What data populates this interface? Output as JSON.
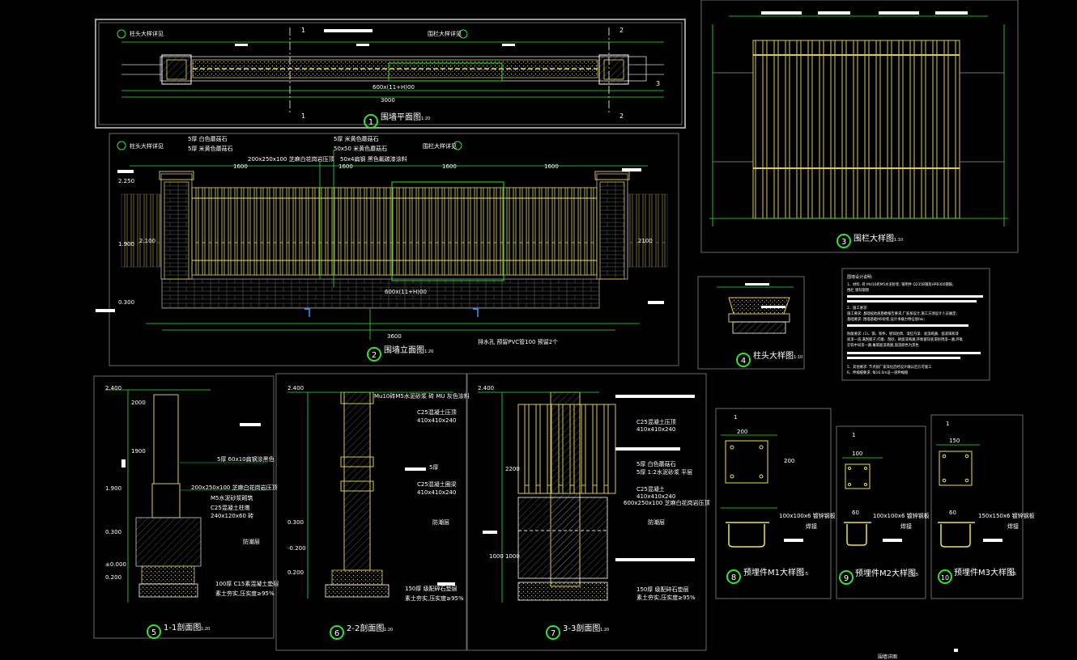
{
  "views": {
    "v1": {
      "num": "1",
      "title": "围墙平面图",
      "scale": "1:20"
    },
    "v2": {
      "num": "2",
      "title": "围墙立面图",
      "scale": "1:20"
    },
    "v3": {
      "num": "3",
      "title": "围栏大样图",
      "scale": "1:10"
    },
    "v4": {
      "num": "4",
      "title": "柱头大样图",
      "scale": "1:10"
    },
    "v5": {
      "num": "5",
      "title": "1-1剖面图",
      "scale": "1:20"
    },
    "v6": {
      "num": "6",
      "title": "2-2剖面图",
      "scale": "1:20"
    },
    "v7": {
      "num": "7",
      "title": "3-3剖面图",
      "scale": "1:20"
    },
    "v8": {
      "num": "8",
      "title": "预埋件M1大样图",
      "scale": "1:5"
    },
    "v9": {
      "num": "9",
      "title": "预埋件M2大样图",
      "scale": "1:5"
    },
    "v10": {
      "num": "10",
      "title": "预埋件M3大样图",
      "scale": "1:5"
    }
  },
  "plan": {
    "label_pillar": "柱头大样详见",
    "label_fence": "围栏大样详见",
    "dim_total": "600x(11+H)00",
    "dim_side": "3000",
    "sec": [
      "1",
      "1",
      "2",
      "2",
      "3"
    ]
  },
  "elev": {
    "note1": "5厚 白色蘑菇石",
    "note2": "5厚 米黄色蘑菇石",
    "note3": "5厚 米黄色蘑菇石",
    "note4": "50x50 米黄色蘑菇石",
    "note5": "200x250x100 芝麻白花岗岩压顶",
    "note6": "50x4扁钢 黑色氟碳漆涂料",
    "label_fence": "围栏大样详见",
    "label_pillar": "柱头大样详见",
    "dim_a": "1600",
    "dim_b": "1600",
    "dim_c": "1600",
    "dim_d": "1600",
    "dim_total": "3600",
    "dim_elev": "600x(11+H)00",
    "drain": "排水孔 预留PVC管100 预留2个",
    "h1": "2.250",
    "h2": "1.900",
    "h3": "0.300",
    "left": "2.100",
    "right": "2100"
  },
  "notes": {
    "head": "围墙设计说明:",
    "l1": "1、材料: 砖 MU10砖M5水泥砂浆; 钢用件 Q235B钢及HPB300钢筋;",
    "l2": "围栏 镀锌钢管",
    "l3": "2、施工要求:",
    "l4": "施工要求: 基础按地质勘察报告要求,厂家按设计,施工方须设计人员确定;",
    "l5": "基础要求: 围墙基础M5砂浆,设计承载力特征值fak;",
    "l6": "防腐要求: (1)、钢、铁件、镀锌防锈、漆红丹漆、底漆两遍、面漆调和漆",
    "l7": "底漆一道,满刮腻子,打磨、刮砂、刷面漆两遍,环氧富锌底漆防锈漆一遍,环氧",
    "l8": "云铁中间漆一遍,氟碳面漆两遍,面漆颜色为黑色",
    "l9": "5、其他要求: 节点按厂家深化后经设计确认后方可施工",
    "l10": "6、伸缩缝要求: 每16.0m设一道伸缩缝"
  },
  "sec1": {
    "elev_top": "2.400",
    "e1": "1.900",
    "e2": "0.300",
    "e3": "±0.000",
    "e4": "0.200",
    "n1": "5厚 60x10扁钢涂黑色",
    "n2": "200x250x100 芝麻白花岗岩压顶",
    "n3": "M5水泥砂浆砌筑",
    "n4": "C25混凝土柱墩",
    "n5": "240x120x60 砖",
    "n6": "防潮层",
    "n7": "100厚 C15素混凝土垫层",
    "n8": "素土夯实,压实度≥95%",
    "d1": "2000",
    "d2": "1900"
  },
  "sec2": {
    "elev_top": "2.400",
    "n0": "Mu10砖M5水泥砂浆 砖 MU 灰色涂料",
    "n1": "C25混凝土压顶",
    "n2": "410x410x240",
    "n3": "C25混凝土圈梁",
    "n4": "410x410x240",
    "n5": "5厚",
    "n6": "防潮层",
    "n7": "150厚 级配碎石垫层",
    "n8": "素土夯实,压实度≥95%",
    "e1": "0.300",
    "e2": "-0.200",
    "e3": "0.200"
  },
  "sec3": {
    "elev_top": "2.400",
    "n1": "C25混凝土压顶",
    "n2": "410x410x240",
    "n3": "5厚 白色蘑菇石",
    "n4": "5厚 1:2水泥砂浆 平层",
    "n5": "C25混凝土",
    "n6": "410x410x240",
    "n7": "600x250x100 芝麻白花岗岩压顶",
    "n8": "防潮层",
    "n9": "150厚 级配碎石垫层",
    "n10": "素土夯实,压实度≥95%",
    "d1": "2200",
    "d2": "1000",
    "d3": "1000"
  },
  "m1": {
    "dim1": "200",
    "dim2": "200",
    "n1": "100x100x6 镀锌钢板",
    "n2": "焊接",
    "n3": "1"
  },
  "m2": {
    "dim1": "100",
    "dim2": "60",
    "n1": "100x100x6 镀锌钢板",
    "n2": "焊接",
    "n3": "1"
  },
  "m3": {
    "dim1": "150",
    "dim2": "60",
    "n1": "150x150x6 镀锌钢板",
    "n2": "焊接",
    "n3": "1"
  },
  "footer": {
    "caption": "围墙详图"
  }
}
